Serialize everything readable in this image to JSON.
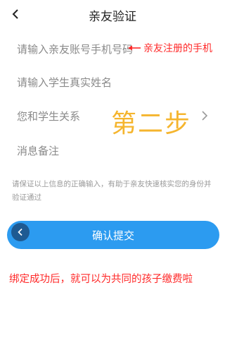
{
  "header": {
    "title": "亲友验证"
  },
  "form": {
    "phone_placeholder": "请输入亲友账号手机号码",
    "name_placeholder": "请输入学生真实姓名",
    "relation_placeholder": "您和学生关系",
    "remark_placeholder": "消息备注"
  },
  "annotations": {
    "phone_hint": "亲友注册的手机",
    "step_label": "第二步",
    "bottom_hint": "绑定成功后，就可以为共同的孩子缴费啦"
  },
  "notice": "请保证以上信息的正确输入，有助于亲友快速核实您的身份并验证通过",
  "buttons": {
    "confirm_label": "确认提交"
  },
  "colors": {
    "accent": "#2c9bf0",
    "annotation": "#ff2a2a",
    "step": "#f5b52e"
  },
  "icons": {
    "back": "chevron-left-icon",
    "relation_arrow": "chevron-right-icon"
  }
}
